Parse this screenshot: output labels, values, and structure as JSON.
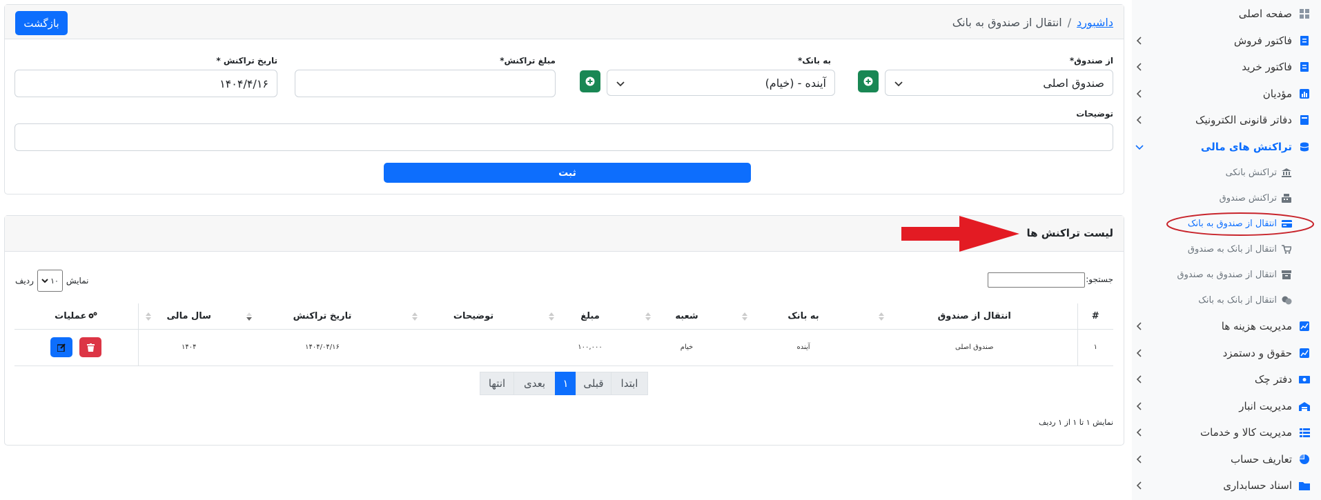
{
  "sidebar": {
    "items": [
      {
        "label": "صفحه اصلی",
        "icon": "dashboard-icon"
      },
      {
        "label": "فاکتور فروش",
        "icon": "invoice-icon"
      },
      {
        "label": "فاکتور خرید",
        "icon": "invoice-icon"
      },
      {
        "label": "مؤدیان",
        "icon": "chart-icon"
      },
      {
        "label": "دفاتر قانونی الکترونیک",
        "icon": "book-icon"
      },
      {
        "label": "تراکنش های مالی",
        "icon": "coins-icon"
      },
      {
        "label": "مدیریت هزینه ها",
        "icon": "line-chart-icon"
      },
      {
        "label": "حقوق و دستمزد",
        "icon": "line-chart-icon"
      },
      {
        "label": "دفتر چک",
        "icon": "money-icon"
      },
      {
        "label": "مدیریت انبار",
        "icon": "warehouse-icon"
      },
      {
        "label": "مدیریت کالا و خدمات",
        "icon": "list-icon"
      },
      {
        "label": "تعاریف حساب",
        "icon": "pie-chart-icon"
      },
      {
        "label": "اسناد حسابداری",
        "icon": "folder-icon"
      }
    ],
    "subitems": [
      {
        "label": "تراکنش بانکی",
        "icon": "bank-icon"
      },
      {
        "label": "تراکنش صندوق",
        "icon": "cash-register-icon"
      },
      {
        "label": "انتقال از صندوق به بانک",
        "icon": "credit-card-icon"
      },
      {
        "label": "انتقال از بانک به صندوق",
        "icon": "cart-icon"
      },
      {
        "label": "انتقال از صندوق به صندوق",
        "icon": "box-icon"
      },
      {
        "label": "انتقال از بانک به بانک",
        "icon": "exchange-icon"
      }
    ]
  },
  "header": {
    "breadcrumb_home": "داشبورد",
    "breadcrumb_sep": "/",
    "breadcrumb_current": "انتقال از صندوق به بانک",
    "back_label": "بازگشت"
  },
  "form": {
    "from_fund_label": "از صندوق*",
    "from_fund_value": "صندوق اصلی",
    "to_bank_label": "به بانک*",
    "to_bank_value": "آینده - (خیام)",
    "amount_label": "مبلغ تراکنش*",
    "amount_value": "",
    "date_label": "تاریخ تراکنش *",
    "date_value": "۱۴۰۴/۴/۱۶",
    "description_label": "توضیحات",
    "description_value": "",
    "submit_label": "ثبت"
  },
  "list": {
    "title": "لیست تراکنش ها",
    "search_label": "جستجو:",
    "search_value": "",
    "show_label": "نمایش",
    "page_size": "۱۰",
    "rows_label": "ردیف",
    "columns": [
      "#",
      "انتقال از صندوق",
      "به بانک",
      "شعبه",
      "مبلغ",
      "توضیحات",
      "تاریخ تراکنش",
      "سال مالی",
      "عملیات"
    ],
    "rows": [
      {
        "num": "۱",
        "from_fund": "صندوق اصلی",
        "to_bank": "آینده",
        "branch": "خیام",
        "amount": "۱۰۰,۰۰۰",
        "description": "",
        "date": "۱۴۰۴/۰۴/۱۶",
        "fiscal_year": "۱۴۰۴"
      }
    ],
    "pager": {
      "first": "ابتدا",
      "prev": "قبلی",
      "current": "۱",
      "next": "بعدی",
      "last": "انتها"
    },
    "info": "نمایش ۱ تا ۱ از ۱ ردیف"
  },
  "colors": {
    "primary": "#0d6efd",
    "success": "#198754",
    "danger": "#dc3545",
    "annotation": "#e31b23"
  }
}
